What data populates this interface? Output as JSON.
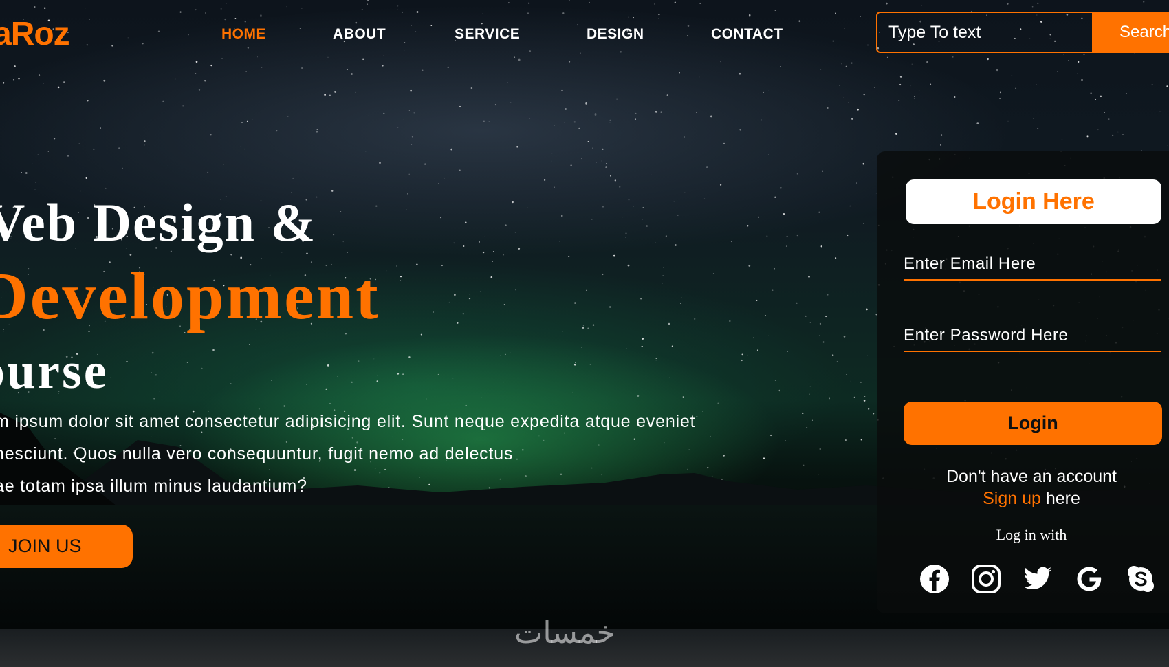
{
  "brand": {
    "logo_text": "aRoz",
    "accent_color": "#ff7200"
  },
  "nav": {
    "items": [
      {
        "label": "HOME",
        "active": true
      },
      {
        "label": "ABOUT",
        "active": false
      },
      {
        "label": "SERVICE",
        "active": false
      },
      {
        "label": "DESIGN",
        "active": false
      },
      {
        "label": "CONTACT",
        "active": false
      }
    ]
  },
  "search": {
    "placeholder": "Type To text",
    "button_label": "Search"
  },
  "hero": {
    "title_line1": "Veb Design &",
    "title_line2": "Development",
    "title_line3": "ourse",
    "text_line1": "m ipsum dolor sit amet consectetur adipisicing elit. Sunt neque expedita atque eveniet",
    "text_line2": "nesciunt. Quos nulla vero consequuntur, fugit nemo ad delectus",
    "text_line3": "ae totam ipsa illum minus laudantium?",
    "join_label": "JOIN US"
  },
  "login": {
    "title": "Login Here",
    "email_placeholder": "Enter Email Here",
    "password_placeholder": "Enter Password Here",
    "button_label": "Login",
    "no_account_text": "Don't have an account",
    "signup_link": "Sign up",
    "signup_suffix": " here",
    "login_with_text": "Log in with",
    "social_icons": [
      "facebook-icon",
      "instagram-icon",
      "twitter-icon",
      "google-icon",
      "skype-icon"
    ]
  },
  "watermark": {
    "text": "خمسات"
  }
}
